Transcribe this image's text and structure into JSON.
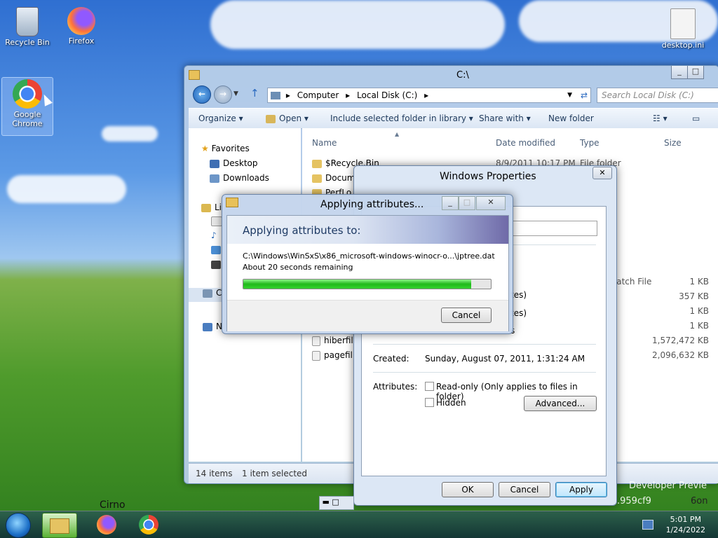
{
  "desktop": {
    "icons": [
      {
        "label": "Recycle Bin",
        "icon": "recycle-bin-icon"
      },
      {
        "label": "Firefox",
        "icon": "firefox-icon"
      },
      {
        "label": "Google Chrome",
        "icon": "chrome-icon"
      },
      {
        "label": "desktop.ini",
        "icon": "settings-file-icon"
      }
    ],
    "bg_text_1": "Developer Previe",
    "bg_text_2": ".959cf9",
    "bg_text_3": "6on",
    "cirno_label": "Cirno"
  },
  "explorer": {
    "title": "C:\\",
    "address": [
      "Computer",
      "Local Disk (C:)"
    ],
    "search_placeholder": "Search Local Disk (C:)",
    "commands": [
      "Organize",
      "Open",
      "Include selected folder in library",
      "Share with",
      "New folder"
    ],
    "nav": {
      "favorites": "Favorites",
      "desktop": "Desktop",
      "downloads": "Downloads",
      "libraries_partial": "Li",
      "computer_partial": "C",
      "network_partial": "N"
    },
    "columns": [
      "Name",
      "Date modified",
      "Type",
      "Size"
    ],
    "rows": [
      {
        "name": "$Recycle.Bin",
        "date": "8/9/2011 10:17 PM",
        "type": "File folder",
        "size": ""
      },
      {
        "name": "Docum",
        "date": "",
        "type": "",
        "size": ""
      },
      {
        "name": "PerfLo",
        "date": "",
        "type": "",
        "size": ""
      },
      {
        "name": "",
        "date": "",
        "type": "Batch File",
        "size": "1 KB"
      },
      {
        "name": "",
        "date": "",
        "type": "e",
        "size": "357 KB"
      },
      {
        "name": "",
        "date": "",
        "type": "e",
        "size": "1 KB"
      },
      {
        "name": "",
        "date": "",
        "type": "e",
        "size": "1 KB"
      },
      {
        "name": "hiberfil",
        "date": "",
        "type": "e",
        "size": "1,572,472 KB"
      },
      {
        "name": "pagefil",
        "date": "",
        "type": "e",
        "size": "2,096,632 KB"
      }
    ],
    "status": {
      "items": "14 items",
      "selected": "1 item selected"
    }
  },
  "properties": {
    "title": "Windows Properties",
    "attr_fragments": [
      "tes)",
      "tes)",
      "s"
    ],
    "created_label": "Created:",
    "created_value": "Sunday, August 07, 2011, 1:31:24 AM",
    "attributes_label": "Attributes:",
    "readonly_label": "Read-only (Only applies to files in folder)",
    "hidden_label": "Hidden",
    "advanced_label": "Advanced...",
    "ok_label": "OK",
    "cancel_label": "Cancel",
    "apply_label": "Apply"
  },
  "progress": {
    "title": "Applying attributes...",
    "heading": "Applying attributes to:",
    "path": "C:\\Windows\\WinSxS\\x86_microsoft-windows-winocr-o...\\jptree.dat",
    "remaining": "About 20 seconds remaining",
    "progress_fraction": 0.92,
    "cancel_label": "Cancel"
  },
  "taskbar": {
    "time": "5:01 PM",
    "date": "1/24/2022",
    "apps": [
      "start-orb-icon",
      "explorer-icon",
      "firefox-icon",
      "chrome-icon"
    ]
  },
  "colors": {
    "accent_blue": "#3c7fb1",
    "progress_green": "#1fb91a"
  }
}
